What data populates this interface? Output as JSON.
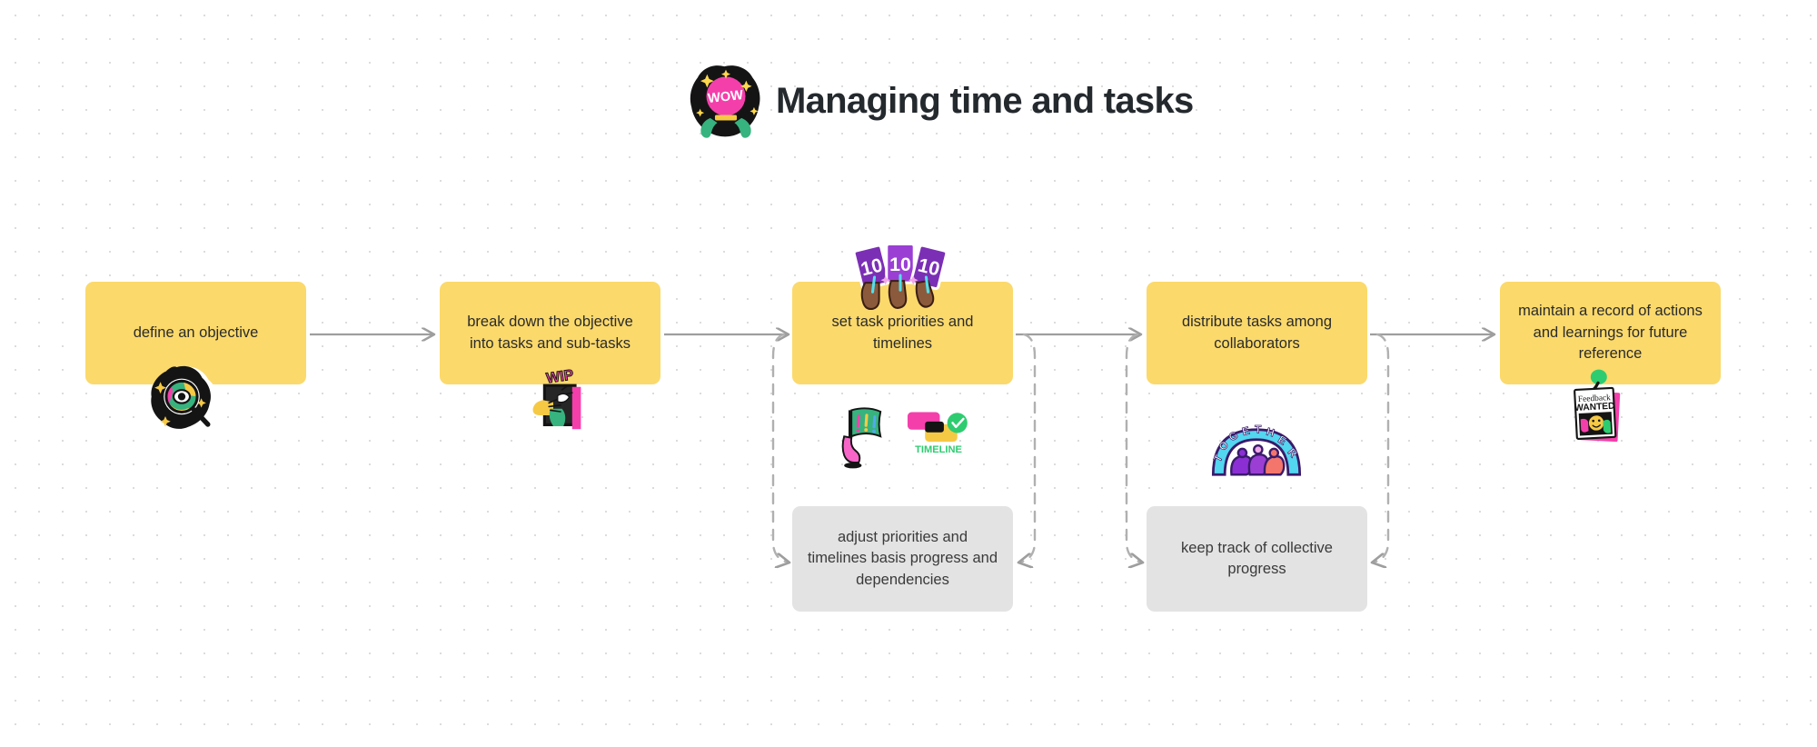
{
  "header": {
    "title": "Managing time and tasks",
    "sticker_icon": "crystal-ball-wow-sticker",
    "sticker_text": "WOW"
  },
  "canvas": {
    "background_color": "#ffffff",
    "dot_color": "#dcdcdc",
    "dot_spacing_px": 26
  },
  "colors": {
    "node_yellow": "#FBD96B",
    "node_grey": "#E3E3E3",
    "connector_grey": "#9e9e9e",
    "title_text": "#24292e",
    "node_text": "#2b2b2b"
  },
  "flow": {
    "main_steps": [
      {
        "id": "step-1",
        "label": "define an objective",
        "type": "yellow",
        "sticker_icon": "magnifying-glass-eye-sticker"
      },
      {
        "id": "step-2",
        "label": "break down the objective into tasks and sub-tasks",
        "type": "yellow",
        "sticker_icon": "wip-hand-sticker",
        "sticker_text": "WIP"
      },
      {
        "id": "step-3",
        "label": "set task priorities and timelines",
        "type": "yellow",
        "sticker_icon": "ten-score-cards-sticker",
        "sticker_text": "10 10 10"
      },
      {
        "id": "step-4",
        "label": "distribute tasks among collaborators",
        "type": "yellow",
        "sticker_icon": "together-people-sticker",
        "sticker_text": "TOGETHER"
      },
      {
        "id": "step-5",
        "label": "maintain a record of actions and learnings for future reference",
        "type": "yellow",
        "sticker_icon": "feedback-wanted-poster-sticker",
        "sticker_text": "Feedback WANTED"
      }
    ],
    "feedback_steps": [
      {
        "id": "feedback-1",
        "label": "adjust priorities and timelines basis progress and dependencies",
        "type": "grey"
      },
      {
        "id": "feedback-2",
        "label": "keep track of collective progress",
        "type": "grey"
      }
    ],
    "extra_stickers": [
      {
        "id": "priority-flag",
        "sticker_icon": "priority-flag-exclamation-sticker"
      },
      {
        "id": "timeline",
        "sticker_icon": "timeline-check-sticker",
        "sticker_text": "TIMELINE"
      }
    ],
    "connectors": [
      {
        "id": "c1",
        "from": "step-1",
        "to": "step-2",
        "style": "solid",
        "direction": "right"
      },
      {
        "id": "c2",
        "from": "step-2",
        "to": "step-3",
        "style": "solid",
        "direction": "right"
      },
      {
        "id": "c3",
        "from": "step-3",
        "to": "step-4",
        "style": "solid",
        "direction": "right"
      },
      {
        "id": "c4",
        "from": "step-4",
        "to": "step-5",
        "style": "solid",
        "direction": "right"
      },
      {
        "id": "c5",
        "from": "step-3",
        "to": "feedback-1",
        "style": "dashed",
        "direction": "loop-left"
      },
      {
        "id": "c6",
        "from": "step-4",
        "to": "feedback-1",
        "style": "dashed",
        "direction": "loop-left"
      },
      {
        "id": "c7",
        "from": "step-4",
        "to": "feedback-2",
        "style": "dashed",
        "direction": "loop-left"
      },
      {
        "id": "c8",
        "from": "step-5",
        "to": "feedback-2",
        "style": "dashed",
        "direction": "loop-left"
      }
    ]
  }
}
